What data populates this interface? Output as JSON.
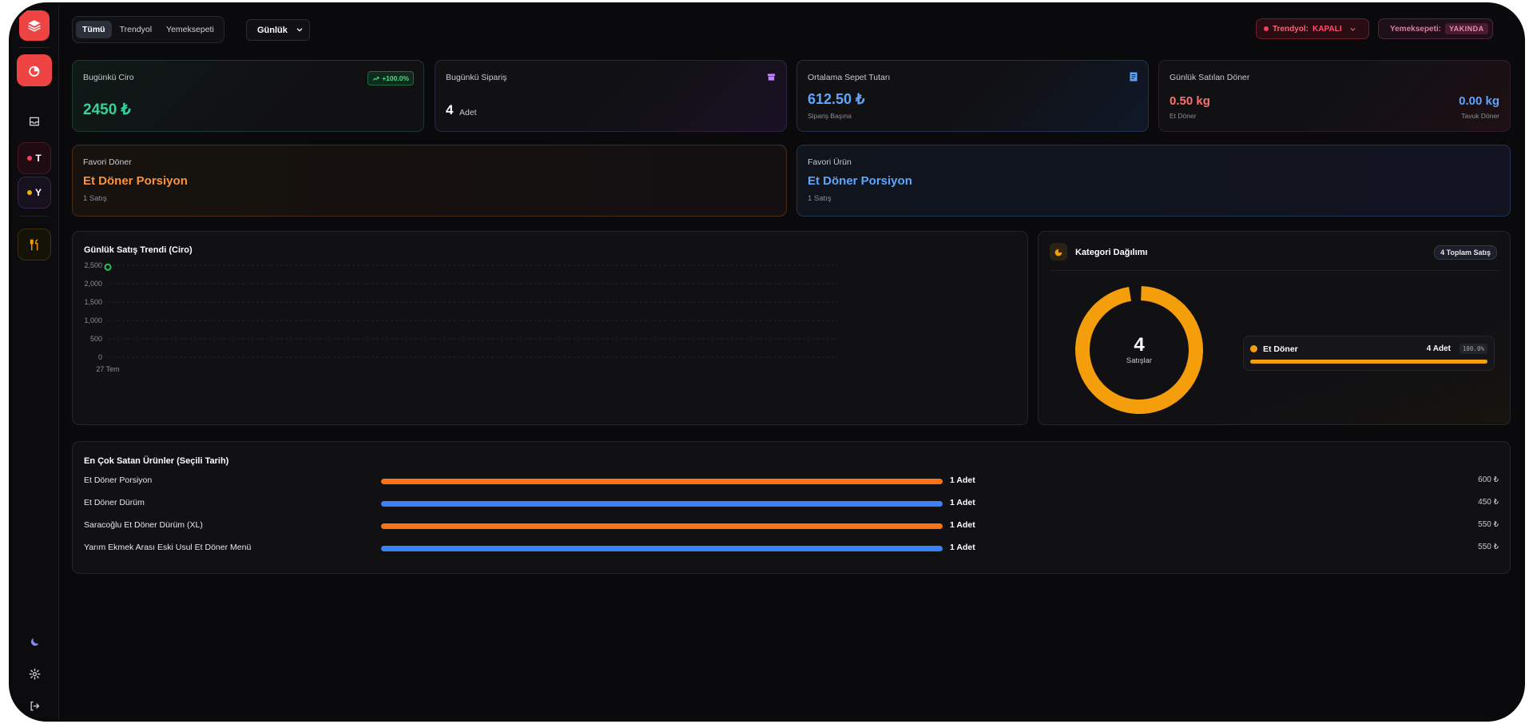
{
  "filters": {
    "tabs": [
      "Tümü",
      "Trendyol",
      "Yemeksepeti"
    ],
    "period": "Günlük"
  },
  "status": {
    "trendyol_label": "Trendyol:",
    "trendyol_value": "KAPALI",
    "yemeksepeti_label": "Yemeksepeti:",
    "yemeksepeti_value": "YAKINDA"
  },
  "sidebar": {
    "trendyol_letter": "T",
    "yemeksepeti_letter": "Y"
  },
  "kpis": {
    "revenue": {
      "label": "Bugünkü Ciro",
      "value": "2450 ₺",
      "change": "+100.0%"
    },
    "orders": {
      "label": "Bugünkü Sipariş",
      "value": "4",
      "unit": "Adet"
    },
    "basket": {
      "label": "Ortalama Sepet Tutarı",
      "value": "612.50 ₺",
      "sub": "Sipariş Başına"
    },
    "doner": {
      "label": "Günlük Satılan Döner",
      "meat_value": "0.50 kg",
      "meat_label": "Et Döner",
      "chicken_value": "0.00 kg",
      "chicken_label": "Tavuk Döner"
    }
  },
  "favorites": {
    "doner": {
      "label": "Favori Döner",
      "name": "Et Döner Porsiyon",
      "sales": "1 Satış"
    },
    "product": {
      "label": "Favori Ürün",
      "name": "Et Döner Porsiyon",
      "sales": "1 Satış"
    }
  },
  "trend": {
    "title": "Günlük Satış Trendi (Ciro)"
  },
  "chart_data": {
    "type": "line",
    "title": "Günlük Satış Trendi (Ciro)",
    "x": [
      "27 Tem"
    ],
    "series": [
      {
        "values": [
          2450
        ]
      }
    ],
    "yticks": [
      "0",
      "500",
      "1,000",
      "1,500",
      "2,000",
      "2,500"
    ],
    "ylim": [
      0,
      2500
    ],
    "grid": true
  },
  "category": {
    "title": "Kategori Dağılımı",
    "total_badge": "4 Toplam Satış",
    "center_value": "4",
    "center_label": "Satışlar",
    "items": [
      {
        "name": "Et Döner",
        "qty": "4 Adet",
        "pct": "100.0%",
        "share": 1.0,
        "color": "#f59e0b"
      }
    ]
  },
  "top_products": {
    "title": "En Çok Satan Ürünler (Seçili Tarih)",
    "rows": [
      {
        "name": "Et Döner Porsiyon",
        "qty": "1 Adet",
        "price": "600 ₺",
        "color": "#f97316",
        "share": 1.0
      },
      {
        "name": "Et Döner Dürüm",
        "qty": "1 Adet",
        "price": "450 ₺",
        "color": "#3b82f6",
        "share": 1.0
      },
      {
        "name": "Saracoğlu Et Döner Dürüm (XL)",
        "qty": "1 Adet",
        "price": "550 ₺",
        "color": "#f97316",
        "share": 1.0
      },
      {
        "name": "Yarım Ekmek Arası Eski Usul Et Döner Menü",
        "qty": "1 Adet",
        "price": "550 ₺",
        "color": "#3b82f6",
        "share": 1.0
      }
    ]
  }
}
